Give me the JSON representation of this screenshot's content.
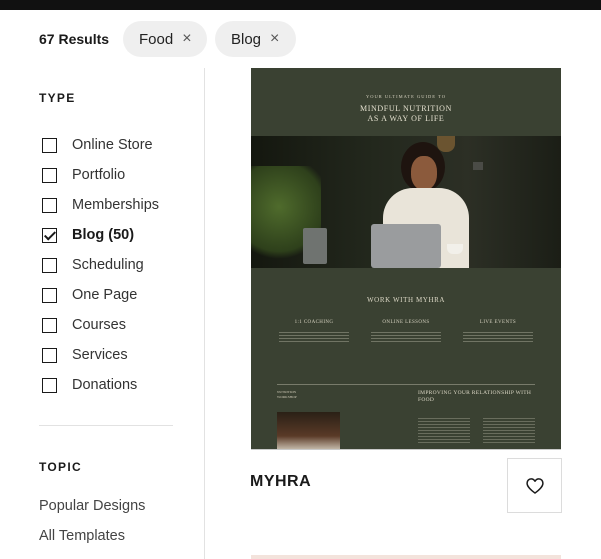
{
  "filters": {
    "result_count": "67 Results",
    "chips": [
      {
        "label": "Food",
        "remove_icon": "close-icon"
      },
      {
        "label": "Blog",
        "remove_icon": "close-icon"
      }
    ]
  },
  "sidebar": {
    "type_title": "TYPE",
    "type_items": [
      {
        "label": "Online Store",
        "checked": false
      },
      {
        "label": "Portfolio",
        "checked": false
      },
      {
        "label": "Memberships",
        "checked": false
      },
      {
        "label": "Blog (50)",
        "checked": true
      },
      {
        "label": "Scheduling",
        "checked": false
      },
      {
        "label": "One Page",
        "checked": false
      },
      {
        "label": "Courses",
        "checked": false
      },
      {
        "label": "Services",
        "checked": false
      },
      {
        "label": "Donations",
        "checked": false
      }
    ],
    "topic_title": "TOPIC",
    "topic_items": [
      "Popular Designs",
      "All Templates"
    ]
  },
  "card": {
    "name": "MYHRA",
    "favorite_icon": "heart-icon",
    "preview": {
      "kicker": "YOUR ULTIMATE GUIDE TO",
      "title_line1": "MINDFUL NUTRITION",
      "title_line2": "AS A WAY OF LIFE",
      "section_title": "WORK WITH MYHRA",
      "services": [
        "1:1 COACHING",
        "ONLINE LESSONS",
        "LIVE EVENTS"
      ],
      "improve_title": "IMPROVING YOUR RELATIONSHIP WITH FOOD",
      "small_left": "NUTRITION\nWORKSHOP"
    }
  },
  "colors": {
    "preview_bg": "#3a4132",
    "chip_bg": "#efefef",
    "accent": "#1a1a1a"
  }
}
